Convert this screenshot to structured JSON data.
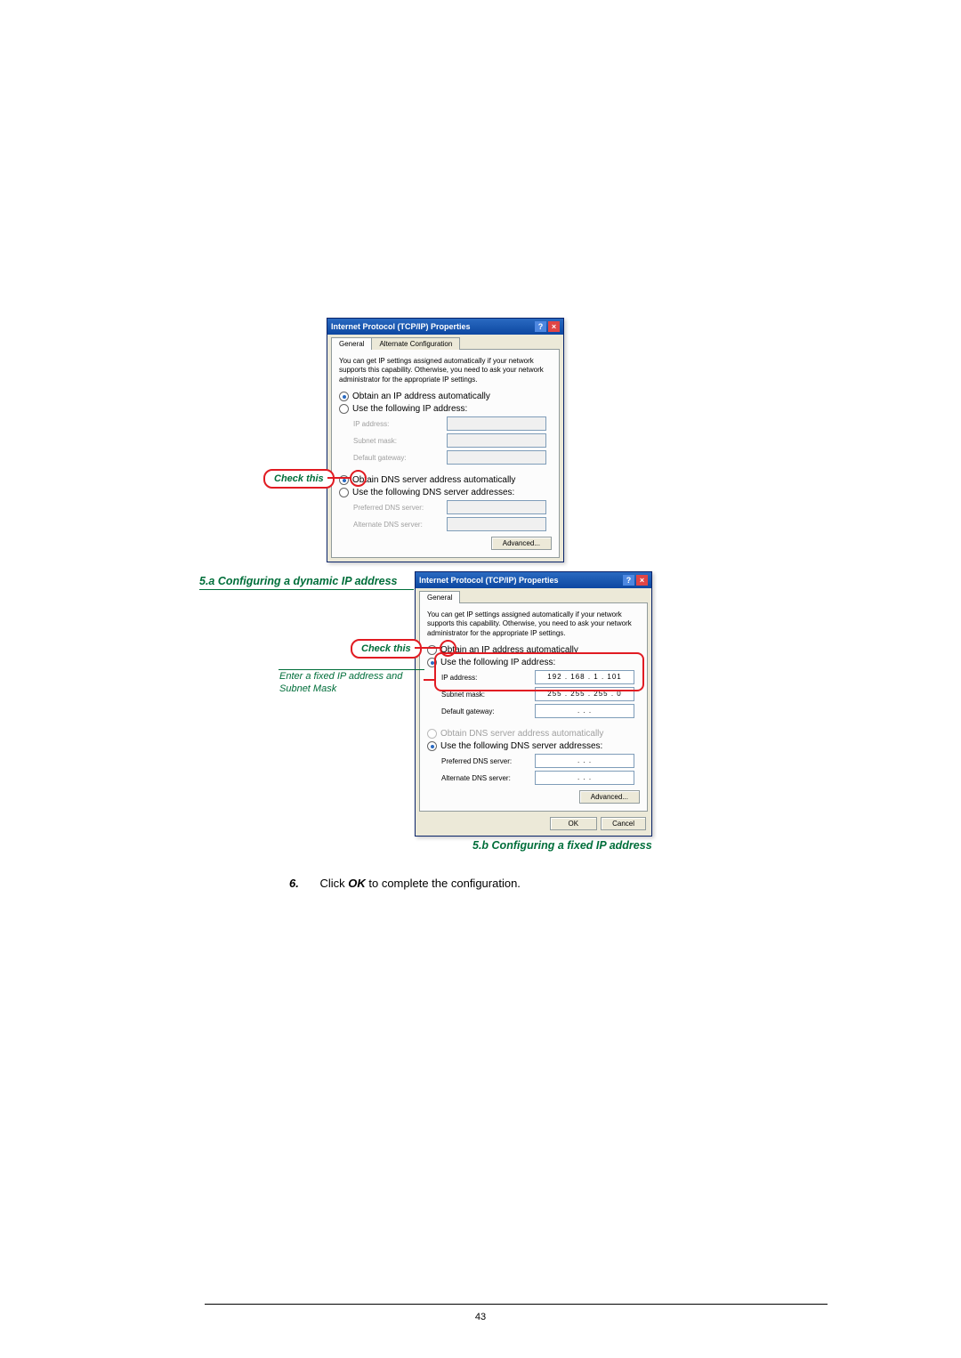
{
  "dialog1": {
    "title": "Internet Protocol (TCP/IP) Properties",
    "tabs": {
      "general": "General",
      "alt": "Alternate Configuration"
    },
    "desc": "You can get IP settings assigned automatically if your network supports this capability. Otherwise, you need to ask your network administrator for the appropriate IP settings.",
    "opt_auto_ip": "Obtain an IP address automatically",
    "opt_manual_ip": "Use the following IP address:",
    "ip_label": "IP address:",
    "subnet_label": "Subnet mask:",
    "gateway_label": "Default gateway:",
    "opt_auto_dns": "Obtain DNS server address automatically",
    "opt_manual_dns": "Use the following DNS server addresses:",
    "pref_dns_label": "Preferred DNS server:",
    "alt_dns_label": "Alternate DNS server:",
    "advanced": "Advanced..."
  },
  "dialog2": {
    "title": "Internet Protocol (TCP/IP) Properties",
    "tab": "General",
    "desc": "You can get IP settings assigned automatically if your network supports this capability. Otherwise, you need to ask your network administrator for the appropriate IP settings.",
    "opt_auto_ip": "Obtain an IP address automatically",
    "opt_manual_ip": "Use the following IP address:",
    "ip_label": "IP address:",
    "ip_value": "192 . 168 .  1  . 101",
    "subnet_label": "Subnet mask:",
    "subnet_value": "255 . 255 . 255 .  0",
    "gateway_label": "Default gateway:",
    "gateway_value": ".     .     .",
    "opt_auto_dns": "Obtain DNS server address automatically",
    "opt_manual_dns": "Use the following DNS server addresses:",
    "pref_dns_label": "Preferred DNS server:",
    "pref_dns_value": ".     .     .",
    "alt_dns_label": "Alternate DNS server:",
    "alt_dns_value": ".     .     .",
    "advanced": "Advanced...",
    "ok": "OK",
    "cancel": "Cancel"
  },
  "callouts": {
    "check_this_1": "Check this",
    "check_this_2": "Check this",
    "enter_fixed": "Enter a fixed IP address and Subnet Mask"
  },
  "captions": {
    "fig_a": "5.a Configuring a dynamic IP address",
    "fig_b": "5.b Configuring a fixed IP address"
  },
  "step6_num": "6.",
  "step6_text_before": "Click ",
  "step6_ok": "OK",
  "step6_text_after": " to complete the configuration.",
  "page_no": "43",
  "icons": {
    "help": "?",
    "close": "×"
  }
}
